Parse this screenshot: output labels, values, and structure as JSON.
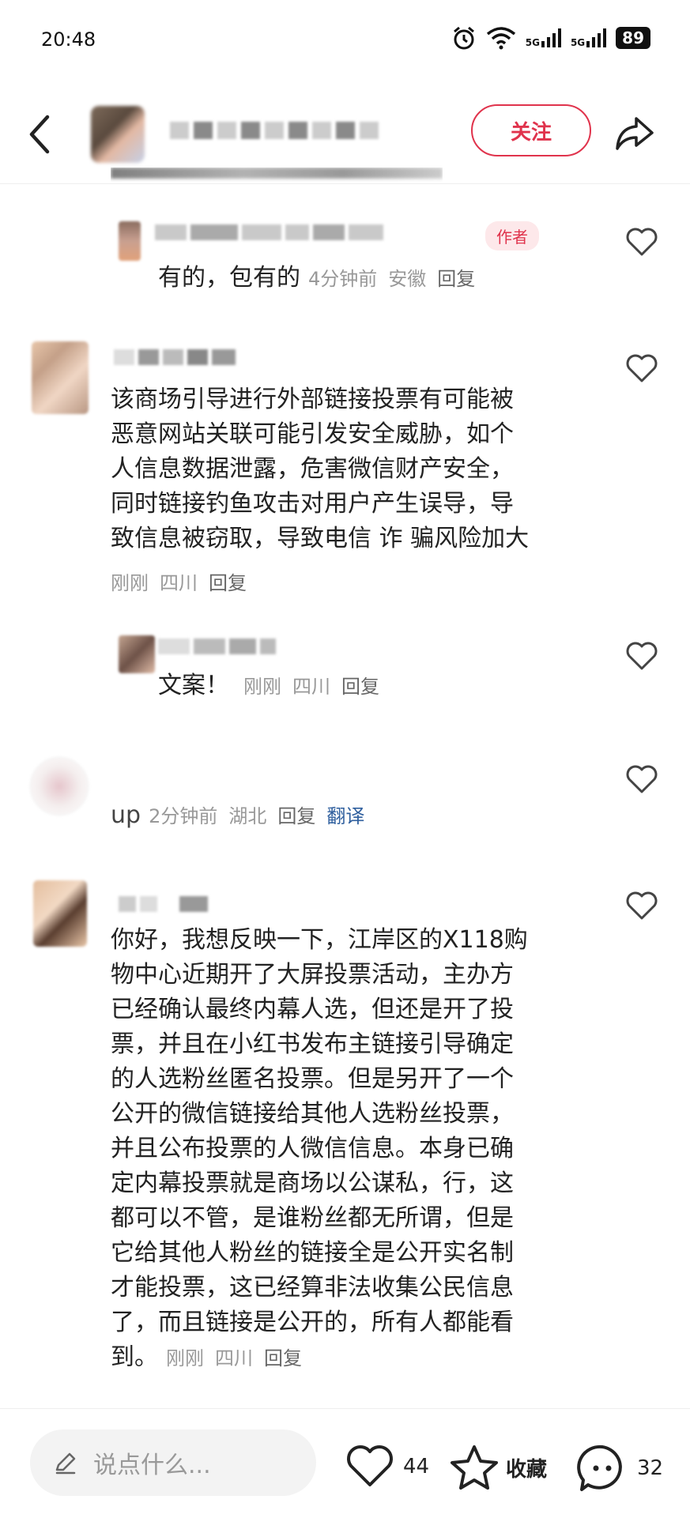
{
  "status": {
    "time": "20:48",
    "network": "5G",
    "battery": "89"
  },
  "header": {
    "follow_label": "关注"
  },
  "comments": [
    {
      "is_author": true,
      "author_tag": "作者",
      "text": "有的，包有的",
      "time": "4分钟前",
      "location": "安徽",
      "reply": "回复"
    },
    {
      "text_lines": [
        "该商场引导进行外部链接投票有可能被",
        "恶意网站关联可能引发安全威胁，如个",
        "人信息数据泄露，危害微信财产安全，",
        "同时链接钓鱼攻击对用户产生误导，导",
        "致信息被窃取，导致电信 诈 骗风险加大"
      ],
      "time": "刚刚",
      "location": "四川",
      "reply": "回复"
    },
    {
      "text": "文案！",
      "time": "刚刚",
      "location": "四川",
      "reply": "回复"
    },
    {
      "text": "up",
      "time": "2分钟前",
      "location": "湖北",
      "reply": "回复",
      "translate": "翻译"
    },
    {
      "text_lines": [
        "你好，我想反映一下，江岸区的X118购",
        "物中心近期开了大屏投票活动，主办方",
        "已经确认最终内幕人选，但还是开了投",
        "票，并且在小红书发布主链接引导确定",
        "的人选粉丝匿名投票。但是另开了一个",
        "公开的微信链接给其他人选粉丝投票，",
        "并且公布投票的人微信信息。本身已确",
        "定内幕投票就是商场以公谋私，行，这",
        "都可以不管，是谁粉丝都无所谓，但是",
        "它给其他人粉丝的链接全是公开实名制",
        "才能投票，这已经算非法收集公民信息",
        "了，而且链接是公开的，所有人都能看"
      ],
      "last_line": "到。",
      "time": "刚刚",
      "location": "四川",
      "reply": "回复"
    }
  ],
  "bottom_bar": {
    "input_placeholder": "说点什么...",
    "like_count": "44",
    "collect_label": "收藏",
    "comment_count": "32"
  }
}
